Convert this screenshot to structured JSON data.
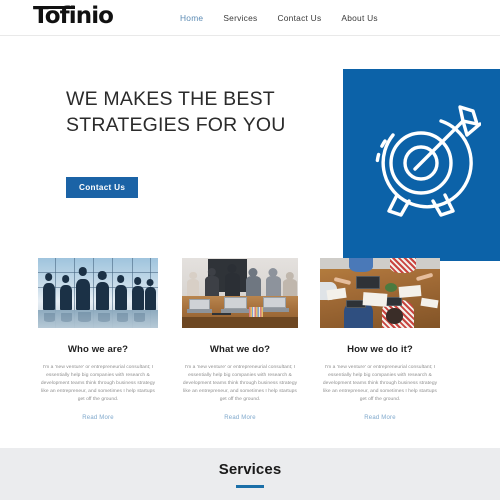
{
  "header": {
    "logo_text": "Tofinio",
    "nav": [
      {
        "label": "Home",
        "active": true
      },
      {
        "label": "Services",
        "active": false
      },
      {
        "label": "Contact Us",
        "active": false
      },
      {
        "label": "About Us",
        "active": false
      }
    ]
  },
  "hero": {
    "title": "WE MAKES THE BEST STRATEGIES FOR YOU",
    "button_label": "Contact Us",
    "panel_icon": "target-arrow-icon",
    "panel_color": "#0c62a8",
    "button_color": "#1b63a6"
  },
  "cards": [
    {
      "image_alt": "business-team-silhouette-photo",
      "title": "Who we are?",
      "body": "I'm a 'new venture' or entrepreneurial consultant; I essentially help big companies with research & development teams think through business strategy like an entrepreneur, and sometimes I help startups get off the ground.",
      "link_label": "Read More"
    },
    {
      "image_alt": "office-meeting-desk-photo",
      "title": "What we do?",
      "body": "I'm a 'new venture' or entrepreneurial consultant; I essentially help big companies with research & development teams think through business strategy like an entrepreneur, and sometimes I help startups get off the ground.",
      "link_label": "Read More"
    },
    {
      "image_alt": "team-collaboration-table-top-view-photo",
      "title": "How we do it?",
      "body": "I'm a 'new venture' or entrepreneurial consultant; I essentially help big companies with research & development teams think through business strategy like an entrepreneur, and sometimes I help startups get off the ground.",
      "link_label": "Read More"
    }
  ],
  "services": {
    "title": "Services",
    "accent_color": "#1b6fa8"
  },
  "colors": {
    "nav_active": "#5c8bb4",
    "link": "#7fa8cc",
    "body_text": "#8d8d8d",
    "heading": "#2b2b2b",
    "section_bg": "#ebecee"
  }
}
